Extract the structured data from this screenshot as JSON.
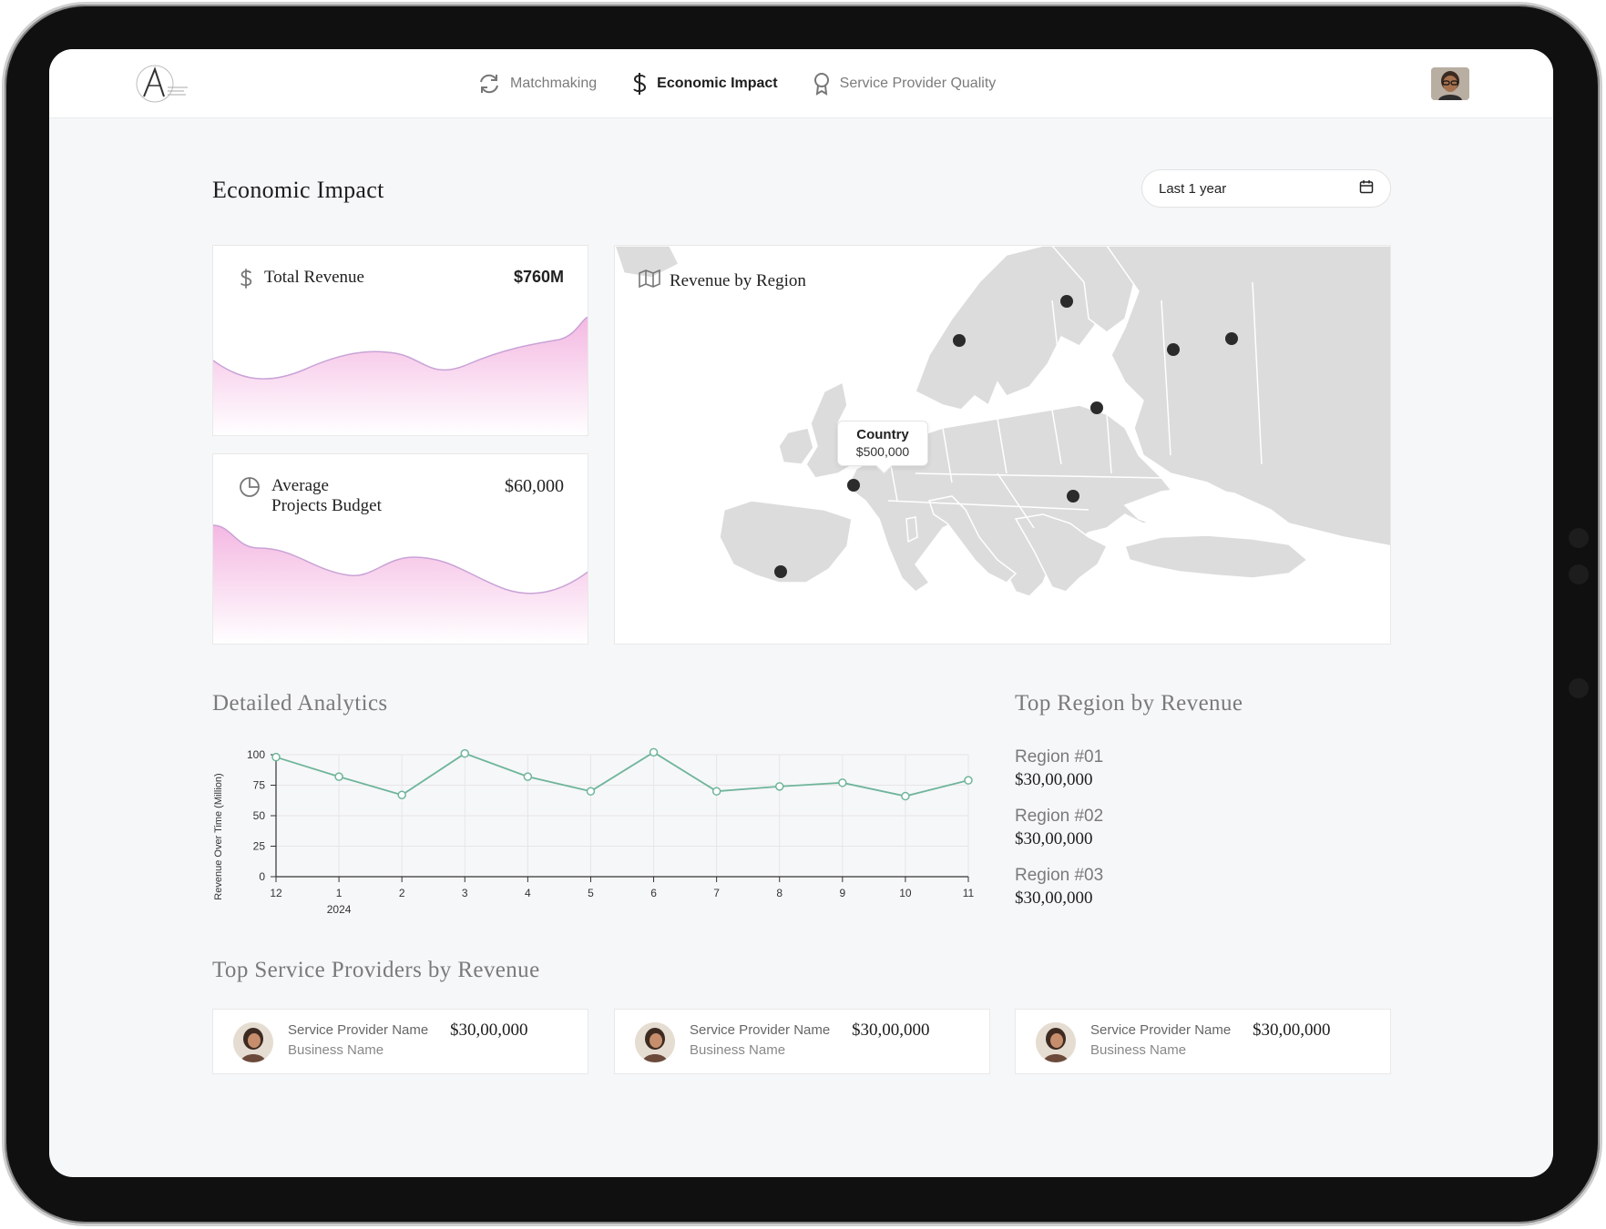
{
  "nav": {
    "items": [
      {
        "label": "Matchmaking",
        "icon": "refresh-icon",
        "active": false
      },
      {
        "label": "Economic Impact",
        "icon": "dollar-icon",
        "active": true
      },
      {
        "label": "Service Provider Quality",
        "icon": "award-icon",
        "active": false
      }
    ]
  },
  "page": {
    "title": "Economic Impact",
    "date_range": "Last 1 year"
  },
  "cards": {
    "total_revenue": {
      "label": "Total Revenue",
      "value": "$760M"
    },
    "avg_budget": {
      "label_line1": "Average",
      "label_line2": "Projects Budget",
      "value": "$60,000"
    }
  },
  "map": {
    "title": "Revenue by Region",
    "tooltip": {
      "label": "Country",
      "value": "$500,000"
    }
  },
  "analytics": {
    "title": "Detailed Analytics",
    "chart_data": {
      "type": "line",
      "ylabel": "Revenue Over Time (Million)",
      "x": [
        "12",
        "1",
        "2",
        "3",
        "4",
        "5",
        "6",
        "7",
        "8",
        "9",
        "10",
        "11"
      ],
      "x_sublabel": {
        "index": 1,
        "text": "2024"
      },
      "y_ticks": [
        0,
        25,
        50,
        75,
        100
      ],
      "ylim": [
        0,
        100
      ],
      "values": [
        98,
        82,
        67,
        101,
        82,
        70,
        102,
        70,
        74,
        77,
        66,
        79
      ],
      "grid": true,
      "color": "#6fb59a"
    }
  },
  "top_regions": {
    "title": "Top Region by Revenue",
    "items": [
      {
        "label": "Region #01",
        "value": "$30,00,000"
      },
      {
        "label": "Region #02",
        "value": "$30,00,000"
      },
      {
        "label": "Region #03",
        "value": "$30,00,000"
      }
    ]
  },
  "providers": {
    "title": "Top Service Providers by Revenue",
    "items": [
      {
        "name": "Service Provider Name",
        "business": "Business Name",
        "value": "$30,00,000"
      },
      {
        "name": "Service Provider Name",
        "business": "Business Name",
        "value": "$30,00,000"
      },
      {
        "name": "Service Provider Name",
        "business": "Business Name",
        "value": "$30,00,000"
      }
    ]
  }
}
